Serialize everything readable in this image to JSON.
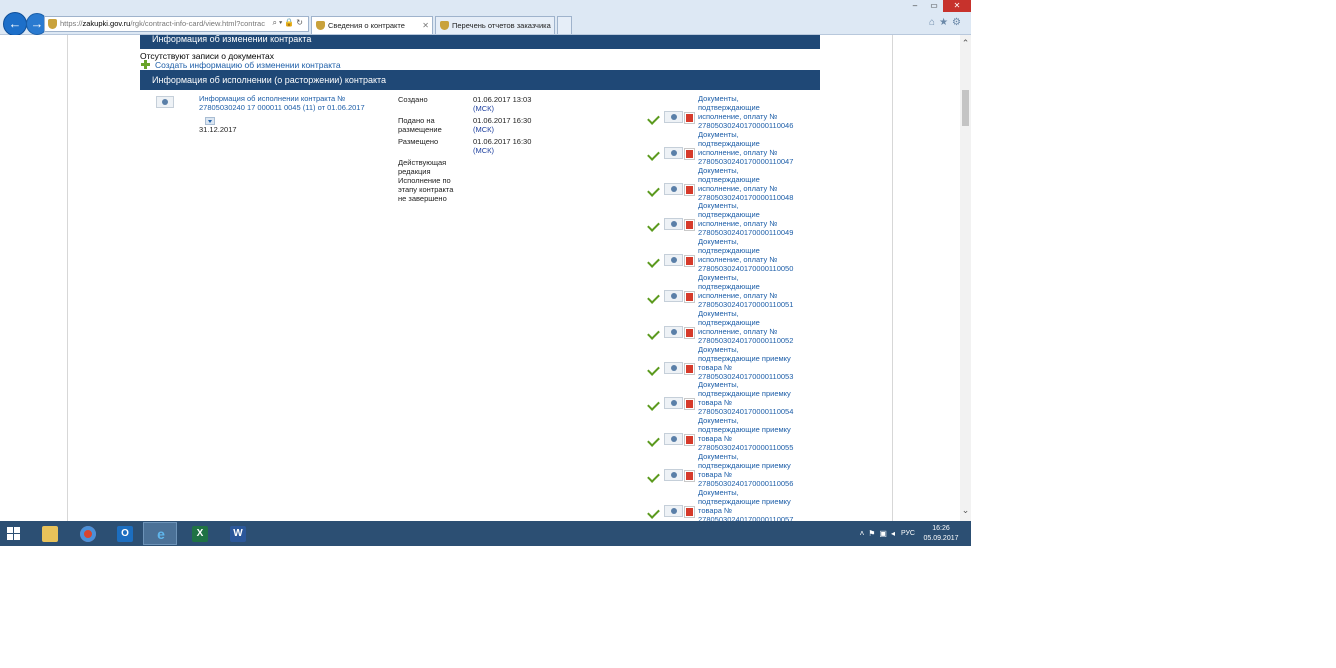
{
  "browser": {
    "url_prefix": "https://",
    "url_domain": "zakupki.gov.ru",
    "url_path": "/rgk/contract-info-card/view.html?contrac",
    "tabs": [
      {
        "label": "Сведения о контракте",
        "active": true
      },
      {
        "label": "Перечень отчетов заказчика",
        "active": false
      }
    ],
    "window_controls": {
      "minimize": "–",
      "maximize": "▭",
      "close": "✕"
    },
    "icons": [
      "home-icon",
      "favorites-icon",
      "settings-icon"
    ]
  },
  "page": {
    "changes_header": "Информация об изменении контракта",
    "no_documents_text": "Отсутствуют записи о документах",
    "create_change_link": "Создать информацию об изменении контракта",
    "execution_header": "Информация об исполнении (о расторжении) контракта",
    "execution": {
      "link_text": "Информация об исполнении контракта № 27805030240 17 000011 0045 (11) от 01.06.2017",
      "date": "31.12.2017",
      "meta": [
        {
          "label": "Создано",
          "value": "01.06.2017 13:03",
          "tz": "(МСК)"
        },
        {
          "label": "Подано на размещение",
          "value": "01.06.2017 16:30",
          "tz": "(МСК)"
        },
        {
          "label": "Размещено",
          "value": "01.06.2017 16:30",
          "tz": "(МСК)"
        }
      ],
      "status_label": "Действующая редакция",
      "status_text": "Исполнение по этапу контракта не завершено"
    },
    "documents": [
      "Документы, подтверждающие исполнение, оплату № 27805030240170000110046",
      "Документы, подтверждающие исполнение, оплату № 27805030240170000110047",
      "Документы, подтверждающие исполнение, оплату № 27805030240170000110048",
      "Документы, подтверждающие исполнение, оплату № 27805030240170000110049",
      "Документы, подтверждающие исполнение, оплату № 27805030240170000110050",
      "Документы, подтверждающие исполнение, оплату № 27805030240170000110051",
      "Документы, подтверждающие исполнение, оплату № 27805030240170000110052",
      "Документы, подтверждающие приемку товара № 27805030240170000110053",
      "Документы, подтверждающие приемку товара № 27805030240170000110054",
      "Документы, подтверждающие приемку товара № 27805030240170000110055",
      "Документы, подтверждающие приемку товара № 27805030240170000110056",
      "Документы, подтверждающие приемку товара № 27805030240170000110057"
    ]
  },
  "taskbar": {
    "apps": [
      "file-explorer",
      "chrome",
      "outlook",
      "internet-explorer",
      "excel",
      "word"
    ],
    "active_app": "internet-explorer",
    "language": "РУС",
    "time": "16:26",
    "date": "05.09.2017"
  },
  "colors": {
    "section_header_bg": "#1f4876",
    "link": "#1d5ea8",
    "taskbar_bg": "#2c4f73",
    "check_green": "#5b9a1e",
    "pdf_red": "#d63a2a"
  }
}
